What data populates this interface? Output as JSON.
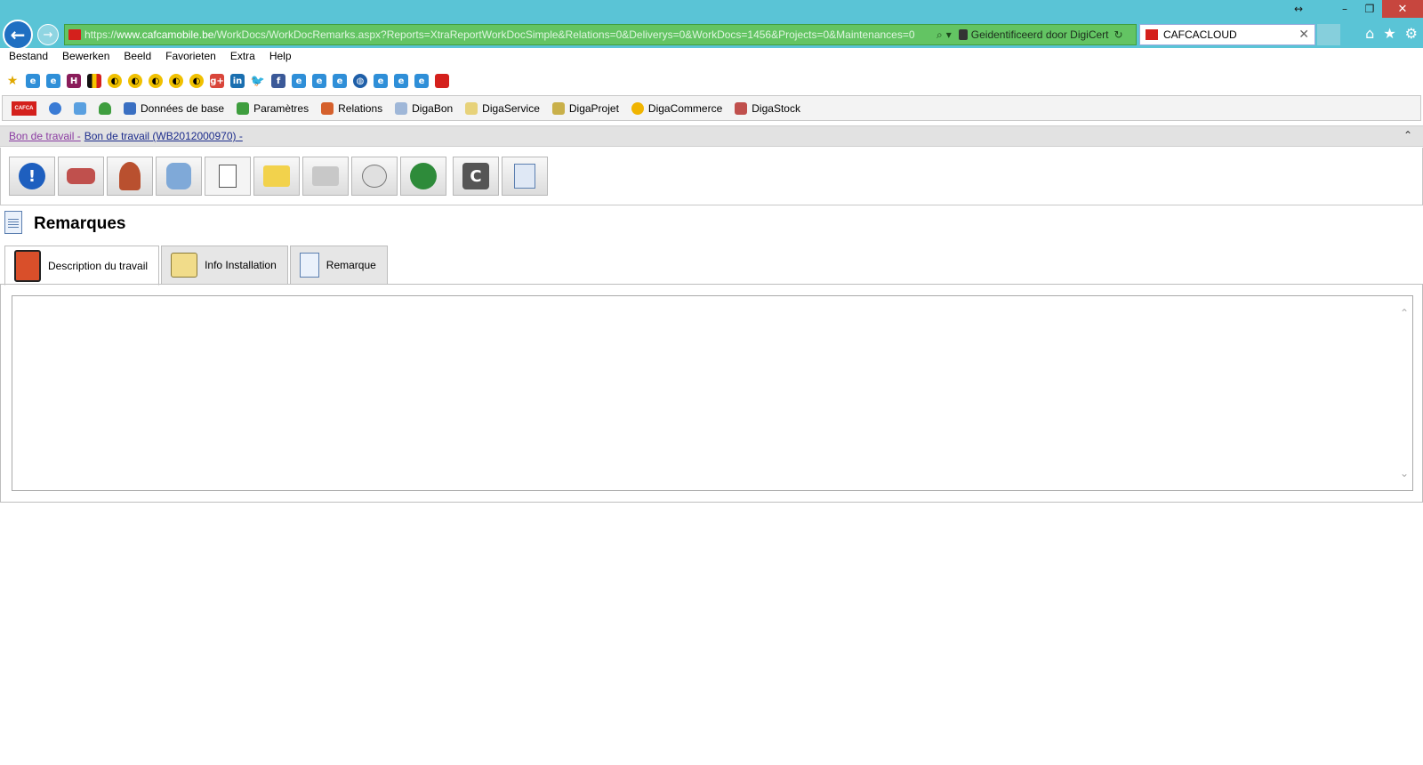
{
  "browser": {
    "url_scheme": "https://",
    "url_host": "www.cafcamobile.be",
    "url_path": "/WorkDocs/WorkDocRemarks.aspx?Reports=XtraReportWorkDocSimple&Relations=0&Deliverys=0&WorkDocs=1456&Projects=0&Maintenances=0",
    "identity_text": "Geidentificeerd door DigiCert",
    "tab_title": "CAFCACLOUD",
    "window_buttons": [
      "minimize-icon",
      "restore-icon",
      "close-icon"
    ]
  },
  "menubar": {
    "items": [
      {
        "label": "Bestand"
      },
      {
        "label": "Bewerken"
      },
      {
        "label": "Beeld"
      },
      {
        "label": "Favorieten"
      },
      {
        "label": "Extra"
      },
      {
        "label": "Help"
      }
    ]
  },
  "favorites": {
    "icons": [
      "star-add-icon",
      "ie-page-icon",
      "ie-page-icon",
      "h-logo-icon",
      "flag-be-icon",
      "moon-icon",
      "moon-icon",
      "moon-icon",
      "moon-icon",
      "moon-icon",
      "google-plus-icon",
      "linkedin-icon",
      "twitter-icon",
      "facebook-icon",
      "ie-page-icon",
      "ie-page-icon",
      "ie-page-icon",
      "globe-icon",
      "ie-page-icon",
      "ie-page-icon",
      "ie-page-icon",
      "cafca-icon"
    ]
  },
  "apptoolbar": {
    "items": [
      {
        "label": "Données de base"
      },
      {
        "label": "Paramètres"
      },
      {
        "label": "Relations"
      },
      {
        "label": "DigaBon"
      },
      {
        "label": "DigaService"
      },
      {
        "label": "DigaProjet"
      },
      {
        "label": "DigaCommerce"
      },
      {
        "label": "DigaStock"
      }
    ],
    "brand_text": "CAFCA"
  },
  "breadcrumb": {
    "part1": "Bon de travail -",
    "part2": "Bon de travail (WB2012000970) -"
  },
  "page": {
    "title": "Remarques"
  },
  "tabs": {
    "items": [
      {
        "label": "Description du travail"
      },
      {
        "label": "Info Installation"
      },
      {
        "label": "Remarque"
      }
    ]
  }
}
